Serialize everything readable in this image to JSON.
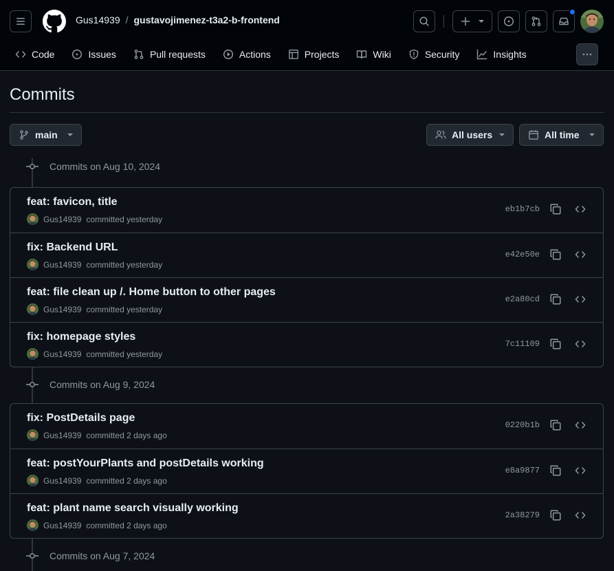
{
  "header": {
    "owner": "Gus14939",
    "separator": "/",
    "repo": "gustavojimenez-t3a2-b-frontend"
  },
  "tabs": [
    {
      "label": "Code",
      "icon": "code-icon"
    },
    {
      "label": "Issues",
      "icon": "issue-icon"
    },
    {
      "label": "Pull requests",
      "icon": "pull-request-icon"
    },
    {
      "label": "Actions",
      "icon": "play-icon"
    },
    {
      "label": "Projects",
      "icon": "table-icon"
    },
    {
      "label": "Wiki",
      "icon": "book-icon"
    },
    {
      "label": "Security",
      "icon": "shield-icon"
    },
    {
      "label": "Insights",
      "icon": "graph-icon"
    }
  ],
  "page": {
    "title": "Commits"
  },
  "filters": {
    "branch": "main",
    "users": "All users",
    "time": "All time"
  },
  "groups": [
    {
      "heading": "Commits on Aug 10, 2024",
      "commits": [
        {
          "message": "feat: favicon, title",
          "author": "Gus14939",
          "when": "committed yesterday",
          "sha": "eb1b7cb"
        },
        {
          "message": "fix: Backend URL",
          "author": "Gus14939",
          "when": "committed yesterday",
          "sha": "e42e50e"
        },
        {
          "message": "feat: file clean up /. Home button to other pages",
          "author": "Gus14939",
          "when": "committed yesterday",
          "sha": "e2a80cd"
        },
        {
          "message": "fix: homepage styles",
          "author": "Gus14939",
          "when": "committed yesterday",
          "sha": "7c11109"
        }
      ]
    },
    {
      "heading": "Commits on Aug 9, 2024",
      "commits": [
        {
          "message": "fix: PostDetails page",
          "author": "Gus14939",
          "when": "committed 2 days ago",
          "sha": "0220b1b"
        },
        {
          "message": "feat: postYourPlants and postDetails working",
          "author": "Gus14939",
          "when": "committed 2 days ago",
          "sha": "e8a9877"
        },
        {
          "message": "feat: plant name search visually working",
          "author": "Gus14939",
          "when": "committed 2 days ago",
          "sha": "2a38279"
        }
      ]
    },
    {
      "heading": "Commits on Aug 7, 2024",
      "commits": []
    }
  ],
  "colors": {
    "background": "#0d1117",
    "header": "#010409",
    "border": "#3d444d",
    "muted": "#9198a1",
    "notification": "#1f6feb"
  }
}
